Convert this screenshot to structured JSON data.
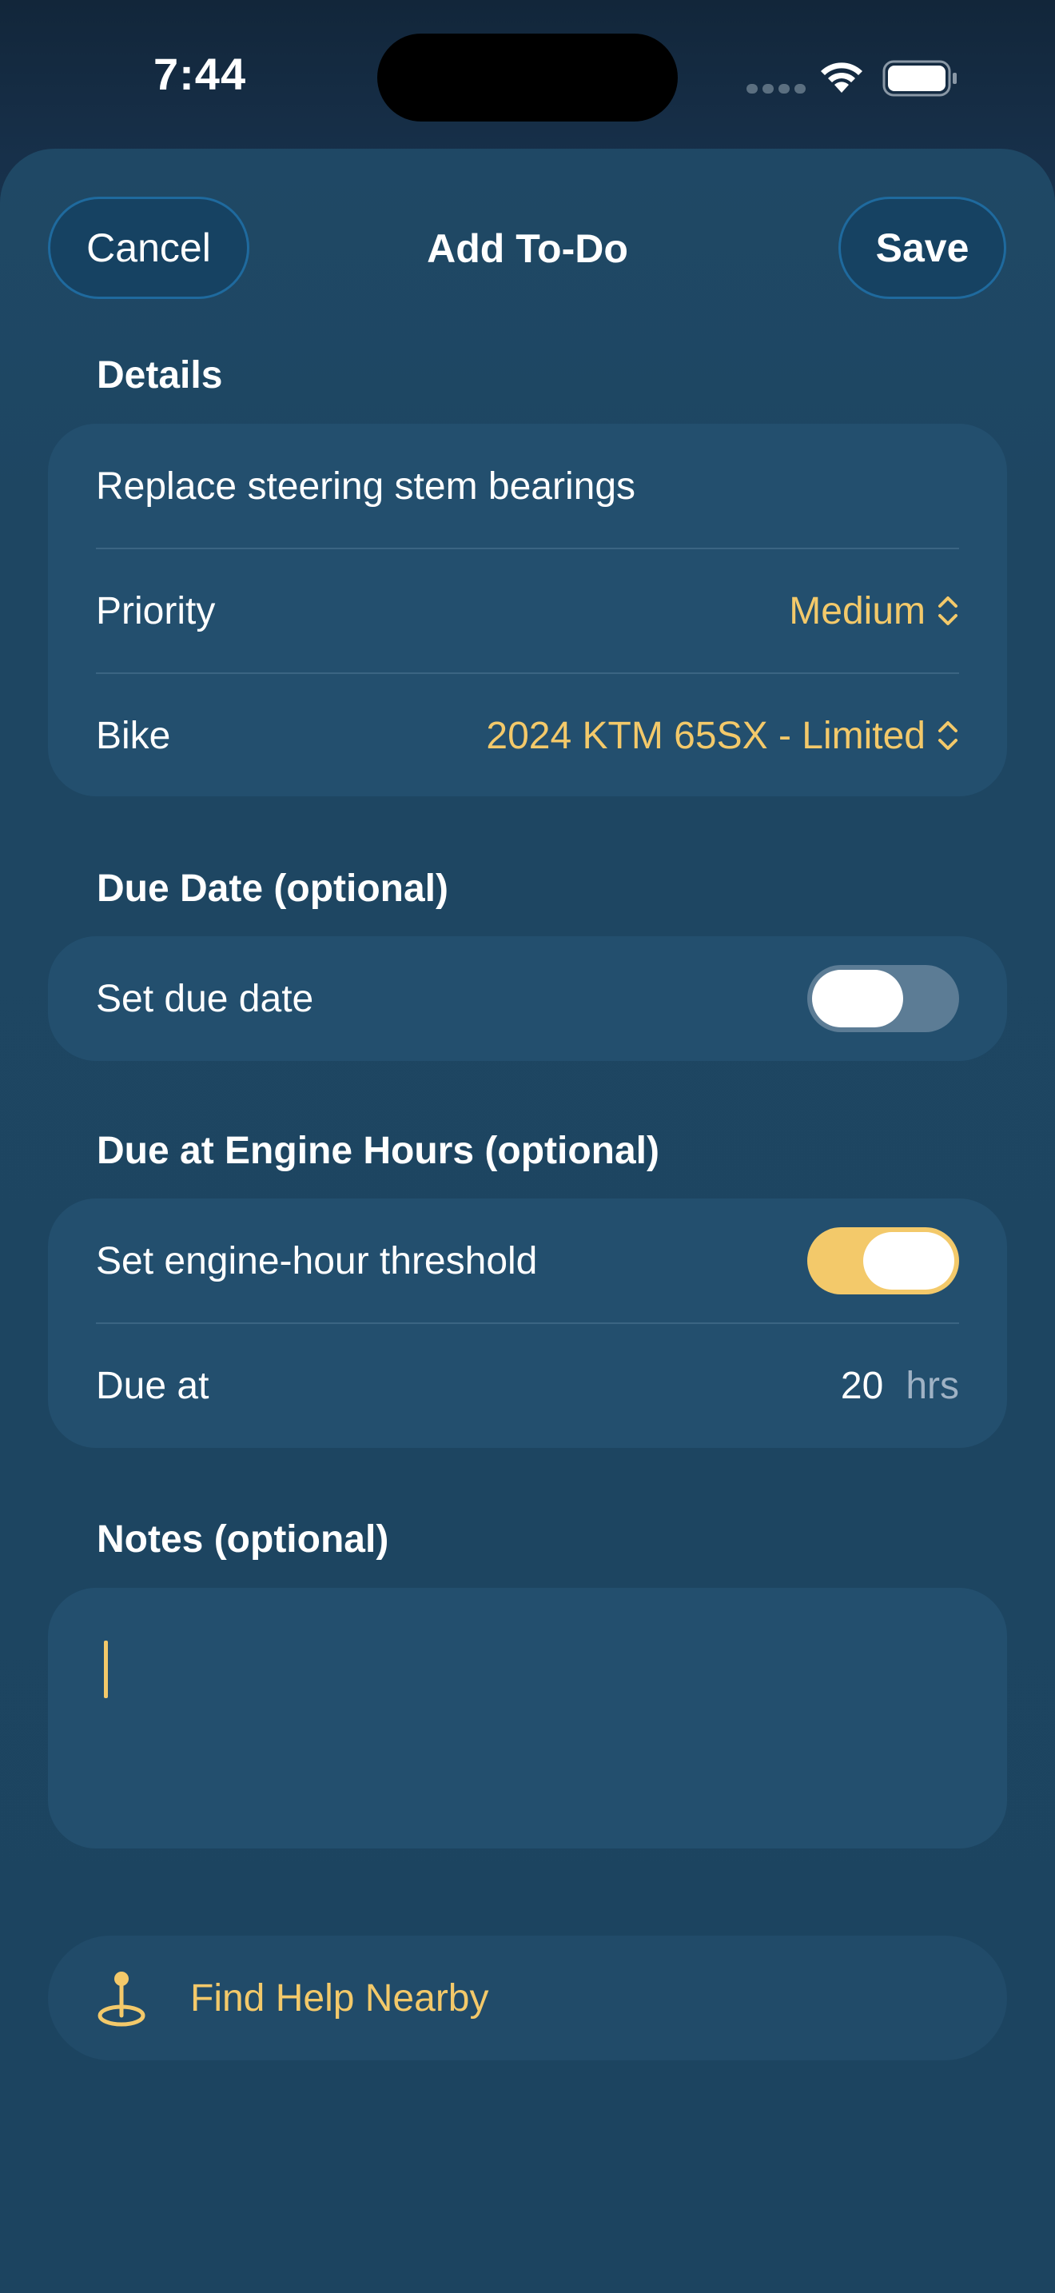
{
  "status_bar": {
    "time": "7:44"
  },
  "nav": {
    "cancel_label": "Cancel",
    "title": "Add To-Do",
    "save_label": "Save"
  },
  "details": {
    "header": "Details",
    "task_title": "Replace steering stem bearings",
    "priority_label": "Priority",
    "priority_value": "Medium",
    "bike_label": "Bike",
    "bike_value": "2024 KTM 65SX - Limited"
  },
  "due_date": {
    "header": "Due Date (optional)",
    "toggle_label": "Set due date",
    "enabled": false
  },
  "engine_hours": {
    "header": "Due at Engine Hours (optional)",
    "toggle_label": "Set engine-hour threshold",
    "enabled": true,
    "due_at_label": "Due at",
    "due_at_value": "20",
    "due_at_unit": "hrs"
  },
  "notes": {
    "header": "Notes (optional)",
    "value": ""
  },
  "find_help": {
    "label": "Find Help Nearby",
    "icon": "map-pin-icon"
  },
  "colors": {
    "accent": "#f3c96a",
    "card": "#234f6e",
    "background": "#1c4460"
  }
}
